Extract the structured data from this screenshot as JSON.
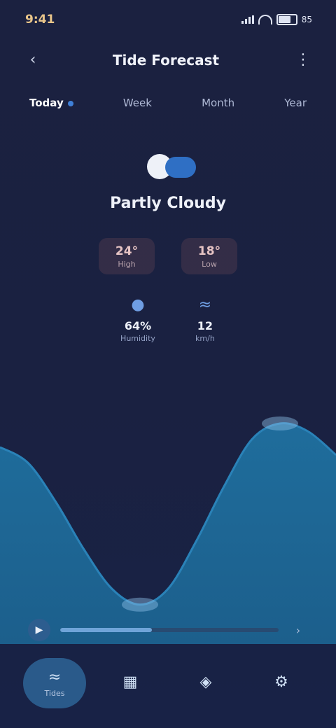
{
  "status": {
    "time": "9:41",
    "battery_pct": 0.85,
    "battery_label": "85"
  },
  "header": {
    "title": "Tide Forecast",
    "subtitle": "",
    "back_icon": "back-icon",
    "menu_icon": "menu-icon"
  },
  "tabs": [
    {
      "label": "Today",
      "active": true
    },
    {
      "label": "Week",
      "active": false
    },
    {
      "label": "Month",
      "active": false
    },
    {
      "label": "Year",
      "active": false
    }
  ],
  "hero": {
    "condition": "Partly Cloudy"
  },
  "temps": [
    {
      "value": "24°",
      "caption": "High"
    },
    {
      "value": "18°",
      "caption": "Low"
    }
  ],
  "stats": [
    {
      "icon": "drop-icon",
      "value": "64%",
      "caption": "Humidity"
    },
    {
      "icon": "wind-icon",
      "value": "12",
      "caption": "km/h"
    }
  ],
  "chart_data": {
    "type": "area",
    "x": [
      0,
      1,
      2,
      3,
      4,
      5,
      6,
      7,
      8,
      9,
      10,
      11,
      12
    ],
    "values": [
      2.1,
      1.9,
      1.4,
      0.8,
      0.3,
      0.1,
      0.3,
      0.9,
      1.6,
      2.2,
      2.4,
      2.3,
      2.0
    ],
    "ylim": [
      -0.4,
      2.8
    ],
    "fill": "#1c5f8c",
    "line": "#1f6d9c"
  },
  "player": {
    "progress": 0.42,
    "time_label": "",
    "play_icon": "play-icon",
    "end_icon": "chevron-right-icon"
  },
  "nav": [
    {
      "icon": "waves-icon",
      "label": "Tides",
      "active": true
    },
    {
      "icon": "calendar-icon",
      "label": "",
      "active": false
    },
    {
      "icon": "map-icon",
      "label": "",
      "active": false
    },
    {
      "icon": "settings-icon",
      "label": "",
      "active": false
    }
  ]
}
